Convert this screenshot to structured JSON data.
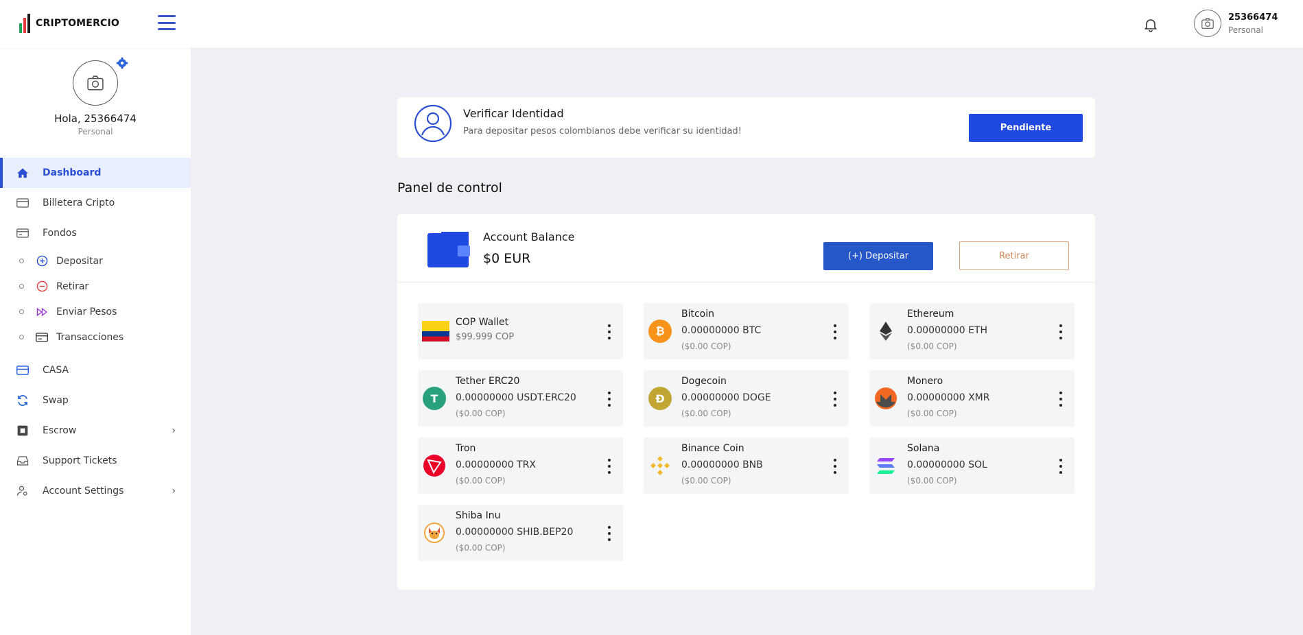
{
  "header": {
    "logo_text": "CRIPTOMERCIO",
    "user_name": "25366474",
    "user_type": "Personal"
  },
  "sidebar": {
    "greeting": "Hola, 25366474",
    "profile_type": "Personal",
    "items": [
      {
        "label": "Dashboard",
        "icon": "home-icon"
      },
      {
        "label": "Billetera Cripto",
        "icon": "wallet-icon"
      },
      {
        "label": "Fondos",
        "icon": "funds-icon"
      },
      {
        "label": "Depositar",
        "icon": "plus-circle-icon"
      },
      {
        "label": "Retirar",
        "icon": "minus-circle-icon"
      },
      {
        "label": "Enviar Pesos",
        "icon": "fast-forward-icon"
      },
      {
        "label": "Transacciones",
        "icon": "card-icon"
      },
      {
        "label": "CASA",
        "icon": "credit-card-icon"
      },
      {
        "label": "Swap",
        "icon": "swap-icon"
      },
      {
        "label": "Escrow",
        "icon": "escrow-icon"
      },
      {
        "label": "Support Tickets",
        "icon": "inbox-icon"
      },
      {
        "label": "Account Settings",
        "icon": "user-settings-icon"
      }
    ]
  },
  "verify": {
    "title": "Verificar Identidad",
    "description": "Para depositar pesos colombianos debe verificar su identidad!",
    "button": "Pendiente"
  },
  "panel": {
    "title": "Panel de control",
    "balance_label": "Account Balance",
    "balance_value": "$0 EUR",
    "deposit_button": "(+) Depositar",
    "withdraw_button": "Retirar"
  },
  "coins": [
    {
      "name": "COP Wallet",
      "amount": "$99.999 COP",
      "fiat": "",
      "icon": "colombia-flag-icon"
    },
    {
      "name": "Bitcoin",
      "amount": "0.00000000 BTC",
      "fiat": "($0.00 COP)",
      "icon": "bitcoin-icon"
    },
    {
      "name": "Ethereum",
      "amount": "0.00000000 ETH",
      "fiat": "($0.00 COP)",
      "icon": "ethereum-icon"
    },
    {
      "name": "Tether ERC20",
      "amount": "0.00000000 USDT.ERC20",
      "fiat": "($0.00 COP)",
      "icon": "tether-icon"
    },
    {
      "name": "Dogecoin",
      "amount": "0.00000000 DOGE",
      "fiat": "($0.00 COP)",
      "icon": "dogecoin-icon"
    },
    {
      "name": "Monero",
      "amount": "0.00000000 XMR",
      "fiat": "($0.00 COP)",
      "icon": "monero-icon"
    },
    {
      "name": "Tron",
      "amount": "0.00000000 TRX",
      "fiat": "($0.00 COP)",
      "icon": "tron-icon"
    },
    {
      "name": "Binance Coin",
      "amount": "0.00000000 BNB",
      "fiat": "($0.00 COP)",
      "icon": "binance-icon"
    },
    {
      "name": "Solana",
      "amount": "0.00000000 SOL",
      "fiat": "($0.00 COP)",
      "icon": "solana-icon"
    },
    {
      "name": "Shiba Inu",
      "amount": "0.00000000 SHIB.BEP20",
      "fiat": "($0.00 COP)",
      "icon": "shiba-inu-icon"
    }
  ],
  "colors": {
    "primary": "#1f49e0",
    "deposit": "#2657c9",
    "withdraw": "#d08b58",
    "active_bg": "#e8eefc",
    "bitcoin": "#f7931a",
    "tether": "#26a17b",
    "dogecoin": "#c2a633",
    "monero": "#f26822",
    "tron": "#eb0029",
    "binance": "#f3ba2f",
    "solana": "#9945ff"
  }
}
